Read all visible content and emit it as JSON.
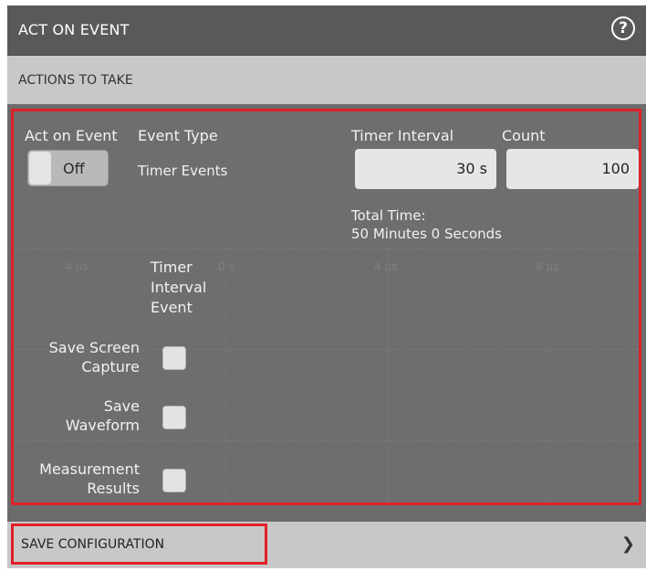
{
  "window": {
    "title": "ACT ON EVENT",
    "help_icon": "help-circle-icon"
  },
  "actions_section": {
    "title": "ACTIONS TO TAKE"
  },
  "act_on_event": {
    "label": "Act on Event",
    "toggle_state": "Off"
  },
  "event_type": {
    "label": "Event Type",
    "value": "Timer Events"
  },
  "timer_interval": {
    "label": "Timer Interval",
    "value": "30 s"
  },
  "count": {
    "label": "Count",
    "value": "100"
  },
  "total_time": {
    "label": "Total Time:",
    "value": "50 Minutes 0 Seconds"
  },
  "event_column": {
    "line1": "Timer",
    "line2": "Interval",
    "line3": "Event"
  },
  "actions": [
    {
      "line1": "Save Screen",
      "line2": "Capture",
      "checked": false
    },
    {
      "line1": "Save",
      "line2": "Waveform",
      "checked": false
    },
    {
      "line1": "Measurement",
      "line2": "Results",
      "checked": false
    }
  ],
  "background_ticks": [
    "-4 µs",
    "0 s",
    "4 µs",
    "8 µs"
  ],
  "footer": {
    "label": "SAVE CONFIGURATION",
    "chevron_icon": "chevron-right-icon"
  },
  "colors": {
    "highlight": "#e0202a",
    "panel": "#6e6e6e",
    "header": "#595959",
    "section": "#c8c8c8"
  }
}
